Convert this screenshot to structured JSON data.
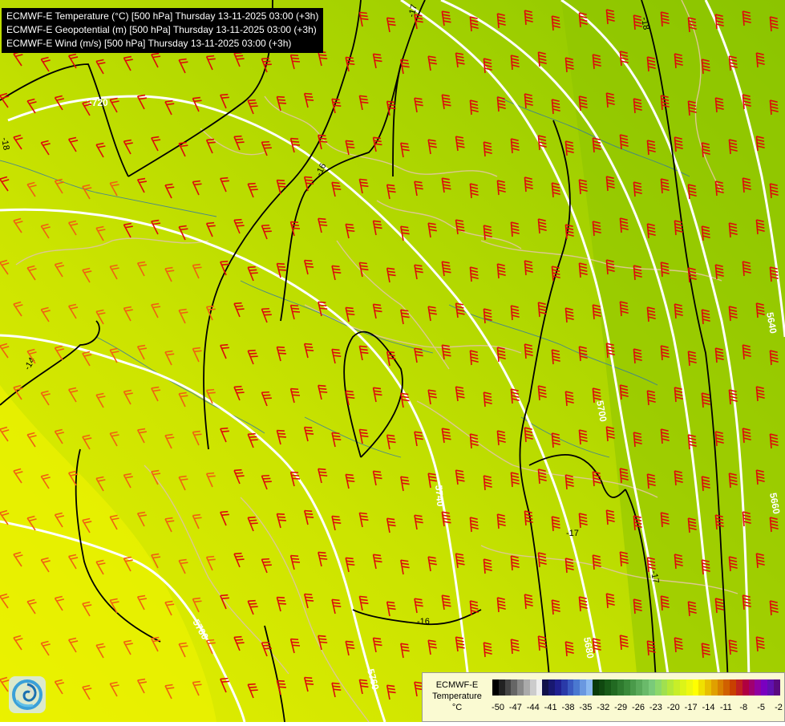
{
  "header": {
    "line1": "ECMWF-E Temperature (°C) [500 hPa] Thursday 13-11-2025 03:00 (+3h)",
    "line2": "ECMWF-E Geopotential (m) [500 hPa] Thursday 13-11-2025 03:00 (+3h)",
    "line3": "ECMWF-E Wind (m/s) [500 hPa] Thursday 13-11-2025 03:00 (+3h)"
  },
  "map": {
    "geopotential_labels": [
      "5720",
      "5640",
      "5700",
      "5740",
      "5780",
      "5760",
      "5680",
      "5660"
    ],
    "temperature_labels": [
      "-18",
      "-16",
      "-14",
      "-17",
      "-16",
      "-17",
      "-18",
      "-17"
    ],
    "colors": {
      "warm_yellow": "#e2ee00",
      "mid_green": "#b6da00",
      "cool_green": "#8cc600",
      "barb": "#dc0a0a",
      "barb_warm": "#f06010",
      "isohypse": "#ffffff",
      "isotherm": "#000000",
      "coastline": "#dcc890",
      "rivers": "#2a70b0"
    }
  },
  "legend": {
    "title_line1": "ECMWF-E",
    "title_line2": "Temperature",
    "unit": "°C",
    "tick_labels": [
      "-50",
      "-47",
      "-44",
      "-41",
      "-38",
      "-35",
      "-32",
      "-29",
      "-26",
      "-23",
      "-20",
      "-17",
      "-14",
      "-11",
      "-8",
      "-5",
      "-2"
    ],
    "colors": [
      "#000000",
      "#222222",
      "#444444",
      "#666666",
      "#888888",
      "#aaaaaa",
      "#cccccc",
      "#eeeeee",
      "#10104a",
      "#181870",
      "#202090",
      "#2a3aa8",
      "#3a5ac0",
      "#4a78d0",
      "#6a98e0",
      "#8ab8f0",
      "#0a3a0a",
      "#104810",
      "#185a18",
      "#226a22",
      "#2e7a2e",
      "#3a8a3a",
      "#4a9a4a",
      "#5aaa5a",
      "#6aba6a",
      "#7aca7a",
      "#8cd86a",
      "#a0e050",
      "#b4e838",
      "#c8ee28",
      "#dcf418",
      "#eef810",
      "#ffff00",
      "#f0e000",
      "#e8c000",
      "#e0a000",
      "#d88000",
      "#d06000",
      "#c84000",
      "#c02020",
      "#b00040",
      "#a00070",
      "#9000a0",
      "#7a00c0",
      "#6010b0",
      "#5a0a80"
    ]
  }
}
